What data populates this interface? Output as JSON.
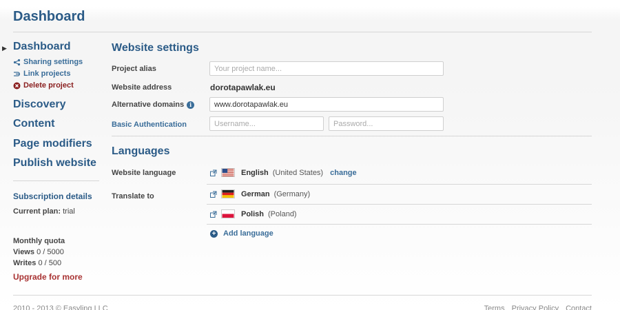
{
  "page": {
    "title": "Dashboard"
  },
  "sidebar": {
    "nav": [
      {
        "label": "Dashboard",
        "active": true
      },
      {
        "label": "Discovery"
      },
      {
        "label": "Content"
      },
      {
        "label": "Page modifiers"
      },
      {
        "label": "Publish website"
      }
    ],
    "sub_items": [
      {
        "label": "Sharing settings",
        "icon": "share-icon"
      },
      {
        "label": "Link projects",
        "icon": "link-icon"
      },
      {
        "label": "Delete project",
        "icon": "delete-icon"
      }
    ],
    "subscription": {
      "heading": "Subscription details",
      "plan_label": "Current plan:",
      "plan_value": "trial",
      "quota_heading": "Monthly quota",
      "views_label": "Views",
      "views_value": "0 / 5000",
      "writes_label": "Writes",
      "writes_value": "0 / 500",
      "upgrade": "Upgrade for more"
    }
  },
  "website_settings": {
    "heading": "Website settings",
    "alias_label": "Project alias",
    "alias_placeholder": "Your project name...",
    "address_label": "Website address",
    "address_value": "dorotapawlak.eu",
    "alt_domains_label": "Alternative domains",
    "alt_domains_value": "www.dorotapawlak.eu",
    "auth_label": "Basic Authentication",
    "username_placeholder": "Username...",
    "password_placeholder": "Password..."
  },
  "languages": {
    "heading": "Languages",
    "website_language_label": "Website language",
    "website_language": {
      "name": "English",
      "region": "(United States)",
      "change": "change"
    },
    "translate_label": "Translate to",
    "targets": [
      {
        "name": "German",
        "region": "(Germany)"
      },
      {
        "name": "Polish",
        "region": "(Poland)"
      }
    ],
    "add_language": "Add language"
  },
  "footer": {
    "copyright": "2010 - 2013 © Easyling LLC",
    "links": [
      "Terms",
      "Privacy Policy",
      "Contact"
    ]
  },
  "colors": {
    "accent": "#2b5b87",
    "link": "#3a6d99",
    "danger": "#a83232"
  }
}
